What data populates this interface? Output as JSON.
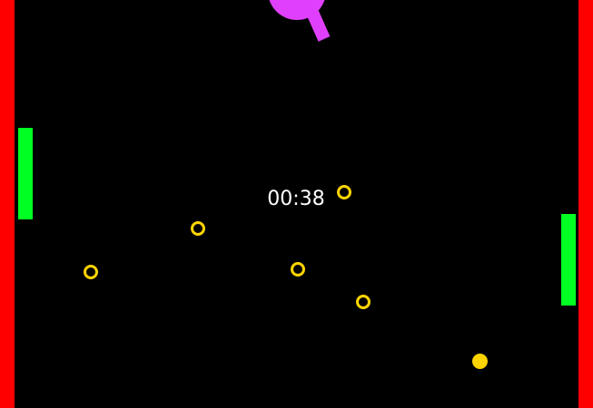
{
  "game": {
    "timer": "00:38"
  },
  "colors": {
    "background": "#000000",
    "walls": "#FF0000",
    "paddles": "#00FF22",
    "rings": "#FFD400",
    "ball": "#FFD400",
    "launcher": "#E040FB",
    "timer_text": "#FFFFFF"
  },
  "elements": {
    "left_wall": "wall",
    "right_wall": "wall",
    "left_paddle": "paddle",
    "right_paddle": "paddle",
    "ring_count": 5,
    "ball": "ball",
    "launcher": "launcher"
  }
}
